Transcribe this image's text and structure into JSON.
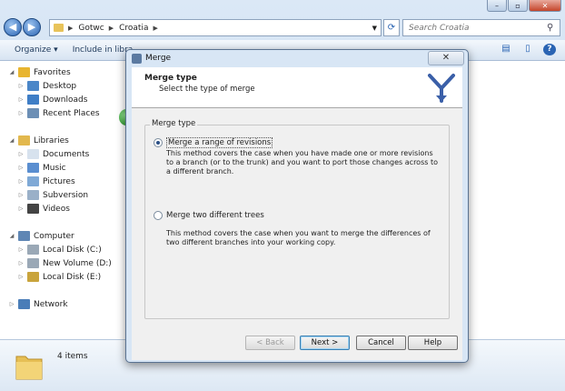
{
  "explorer": {
    "address_segments": [
      "Gotwc",
      "Croatia"
    ],
    "search_placeholder": "Search Croatia",
    "toolbar": [
      {
        "label": "Organize ▾"
      },
      {
        "label": "Include in libra"
      }
    ],
    "nav": [
      {
        "label": "Favorites",
        "level": 0,
        "icon": "star-icon",
        "color": "#e8b530"
      },
      {
        "label": "Desktop",
        "level": 1,
        "icon": "desktop-icon",
        "color": "#4a86c8"
      },
      {
        "label": "Downloads",
        "level": 1,
        "icon": "downloads-icon",
        "color": "#3f7ec6"
      },
      {
        "label": "Recent Places",
        "level": 1,
        "icon": "recent-places-icon",
        "color": "#6c8fb5"
      },
      {
        "label": "Libraries",
        "level": 0,
        "icon": "libraries-icon",
        "color": "#e2b84e"
      },
      {
        "label": "Documents",
        "level": 1,
        "icon": "documents-icon",
        "color": "#d7e2ee"
      },
      {
        "label": "Music",
        "level": 1,
        "icon": "music-icon",
        "color": "#5a8ed0"
      },
      {
        "label": "Pictures",
        "level": 1,
        "icon": "pictures-icon",
        "color": "#7fa9d6"
      },
      {
        "label": "Subversion",
        "level": 1,
        "icon": "subversion-icon",
        "color": "#9ab0c8"
      },
      {
        "label": "Videos",
        "level": 1,
        "icon": "videos-icon",
        "color": "#444444"
      },
      {
        "label": "Computer",
        "level": 0,
        "icon": "computer-icon",
        "color": "#5e86b4"
      },
      {
        "label": "Local Disk (C:)",
        "level": 1,
        "icon": "drive-icon",
        "color": "#9aa8b6"
      },
      {
        "label": "New Volume (D:)",
        "level": 1,
        "icon": "drive-icon",
        "color": "#9aa8b6"
      },
      {
        "label": "Local Disk (E:)",
        "level": 1,
        "icon": "drive-locked-icon",
        "color": "#c9a43c"
      },
      {
        "label": "Network",
        "level": 0,
        "icon": "network-icon",
        "color": "#4a7db8"
      }
    ],
    "status_items": "4 items"
  },
  "dialog": {
    "title": "Merge",
    "close": "✕",
    "header_title": "Merge type",
    "header_subtitle": "Select the type of merge",
    "group_label": "Merge type",
    "option1_label": "Merge a range of revisions",
    "option1_desc": "This method covers the case when you have made one or more revisions to a branch (or to the trunk) and you want to port those changes across to a different branch.",
    "option2_label": "Merge two different trees",
    "option2_desc": "This method covers the case when you want to merge the differences of two different branches into your working copy.",
    "buttons": {
      "back": "< Back",
      "next": "Next >",
      "cancel": "Cancel",
      "help": "Help"
    },
    "accent_color": "#3a5fa8"
  }
}
